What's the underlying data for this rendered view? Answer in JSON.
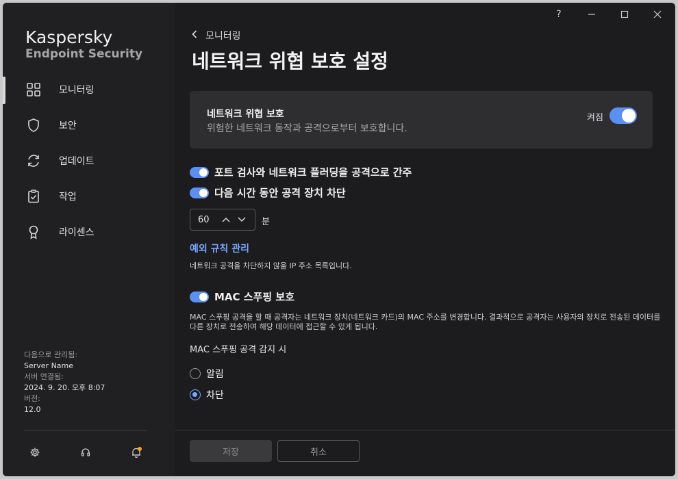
{
  "app": {
    "brand_line1": "Kaspersky",
    "brand_line2": "Endpoint Security"
  },
  "titlebar": {
    "help": "?",
    "minimize": "—",
    "maximize": "☐",
    "close": "✕"
  },
  "sidebar": {
    "items": [
      {
        "label": "모니터링",
        "icon": "dashboard-icon",
        "active": true
      },
      {
        "label": "보안",
        "icon": "shield-icon",
        "active": false
      },
      {
        "label": "업데이트",
        "icon": "refresh-icon",
        "active": false
      },
      {
        "label": "작업",
        "icon": "clipboard-icon",
        "active": false
      },
      {
        "label": "라이센스",
        "icon": "license-icon",
        "active": false
      }
    ],
    "meta": {
      "managed_by_label": "다음으로 관리됨:",
      "managed_by_value": "Server Name",
      "server_conn_label": "서버 연결됨:",
      "server_conn_value": "2024. 9. 20. 오후 8:07",
      "version_label": "버전:",
      "version_value": "12.0"
    }
  },
  "main": {
    "back_label": "모니터링",
    "title": "네트워크 위협 보호 설정",
    "card": {
      "heading": "네트워크 위협 보호",
      "description": "위험한 네트워크 동작과 공격으로부터 보호합니다.",
      "state": "켜짐",
      "enabled": true
    },
    "option_port_scan": "포트 검사와 네트워크 플러딩을 공격으로 간주",
    "option_block": "다음 시간 동안 공격 장치 차단",
    "block_minutes": "60",
    "block_unit": "분",
    "exclusions_link": "예외 규칙 관리",
    "exclusions_note": "네트워크 공격을 차단하지 않을 IP 주소 목록입니다.",
    "mac_title": "MAC 스푸핑 보호",
    "mac_description": "MAC 스푸핑 공격을 할 때 공격자는 네트워크 장치(네트워크 카드)의 MAC 주소를 변경합니다. 결과적으로 공격자는 사용자의 장치로 전송된 데이터를 다른 장치로 전송하여 해당 데이터에 접근할 수 있게 됩니다.",
    "mac_detect_heading": "MAC 스푸핑 공격 감지 시",
    "radio_options": [
      {
        "label": "알림",
        "selected": false
      },
      {
        "label": "차단",
        "selected": true
      }
    ]
  },
  "footer": {
    "save_label": "저장",
    "cancel_label": "취소"
  },
  "colors": {
    "accent": "#5b8ff0",
    "link": "#7aa7ff",
    "notification_dot": "#f5a623"
  }
}
